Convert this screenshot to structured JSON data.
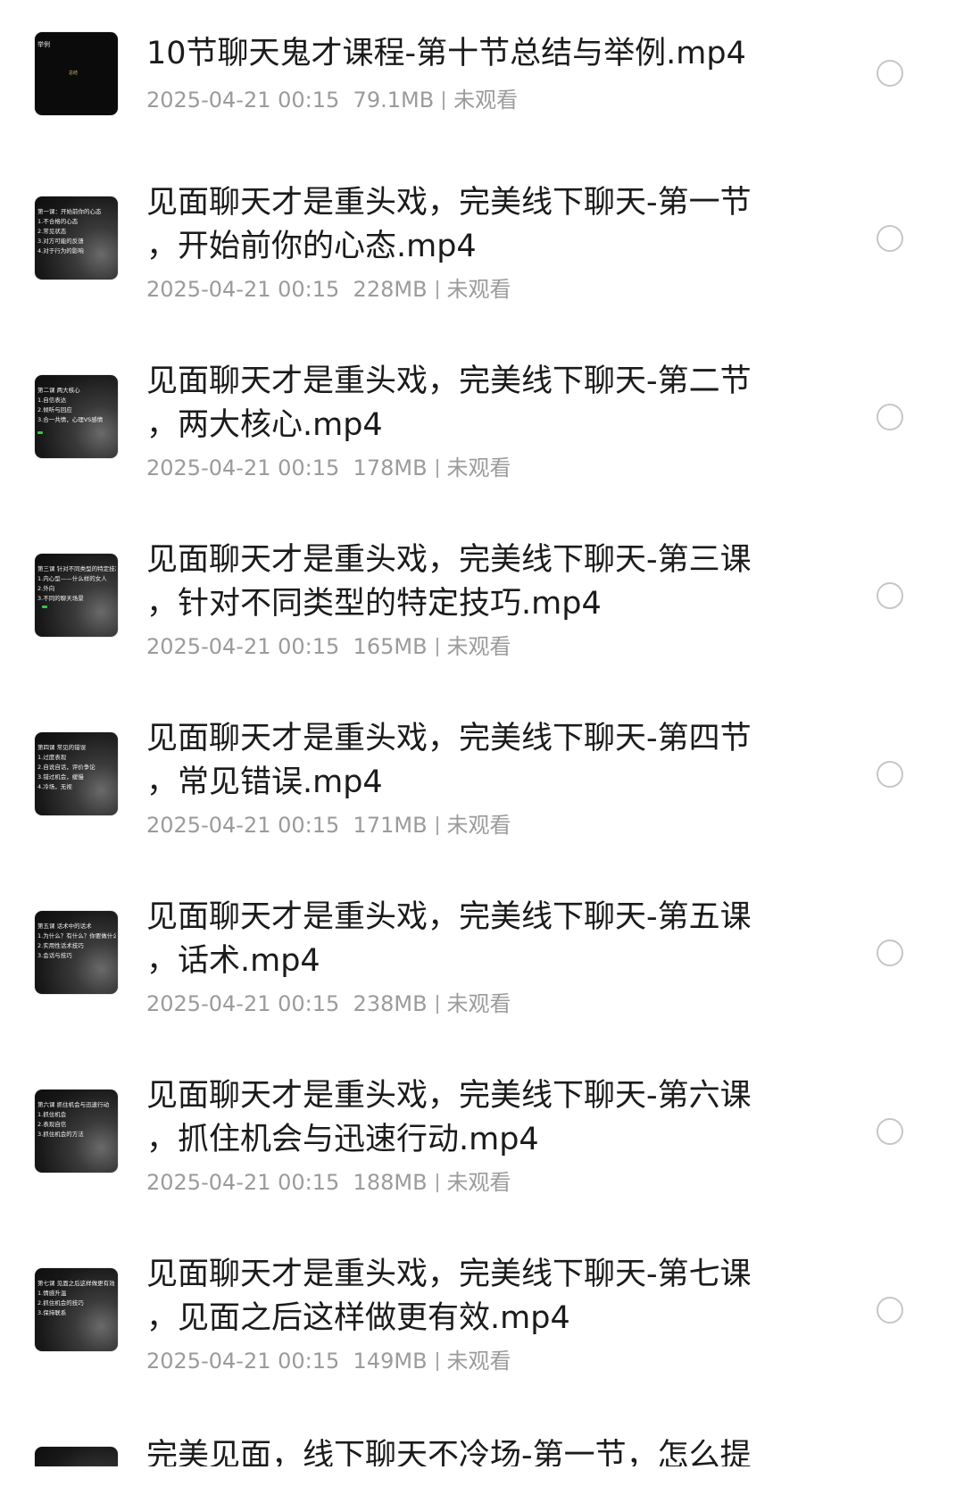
{
  "items": [
    {
      "title_line1": "10节聊天鬼才课程-第十节总结与举例.mp4",
      "title_line2": "",
      "date": "2025-04-21 00:15",
      "size": "79.1MB",
      "status": "未观看"
    },
    {
      "title_line1": "见面聊天才是重头戏，完美线下聊天-第一节",
      "title_line2": "，开始前你的心态.mp4",
      "date": "2025-04-21 00:15",
      "size": "228MB",
      "status": "未观看"
    },
    {
      "title_line1": "见面聊天才是重头戏，完美线下聊天-第二节",
      "title_line2": "，两大核心.mp4",
      "date": "2025-04-21 00:15",
      "size": "178MB",
      "status": "未观看"
    },
    {
      "title_line1": "见面聊天才是重头戏，完美线下聊天-第三课",
      "title_line2": "，针对不同类型的特定技巧.mp4",
      "date": "2025-04-21 00:15",
      "size": "165MB",
      "status": "未观看"
    },
    {
      "title_line1": "见面聊天才是重头戏，完美线下聊天-第四节",
      "title_line2": "，常见错误.mp4",
      "date": "2025-04-21 00:15",
      "size": "171MB",
      "status": "未观看"
    },
    {
      "title_line1": "见面聊天才是重头戏，完美线下聊天-第五课",
      "title_line2": "，话术.mp4",
      "date": "2025-04-21 00:15",
      "size": "238MB",
      "status": "未观看"
    },
    {
      "title_line1": "见面聊天才是重头戏，完美线下聊天-第六课",
      "title_line2": "，抓住机会与迅速行动.mp4",
      "date": "2025-04-21 00:15",
      "size": "188MB",
      "status": "未观看"
    },
    {
      "title_line1": "见面聊天才是重头戏，完美线下聊天-第七课",
      "title_line2": "，见面之后这样做更有效.mp4",
      "date": "2025-04-21 00:15",
      "size": "149MB",
      "status": "未观看"
    },
    {
      "title_line1": "完美见面，线下聊天不冷场-第一节，怎么提",
      "title_line2": "",
      "date": "",
      "size": "",
      "status": ""
    }
  ],
  "thumbs": [
    {
      "text": "举例",
      "center": "总结"
    },
    {
      "text": "第一课：开始前你的心态\n1.不合格的心态\n2.常见状态\n3.对方可能的反馈\n4.对于行为的影响"
    },
    {
      "text": "第二课 两大核心\n1.自信表达\n2.倾听与回应\n3.合一共情，心理VS感情"
    },
    {
      "text": "第三课 针对不同类型的特定技巧\n1.内心型——什么样的女人\n2.外向\n3.不同的聊天场景"
    },
    {
      "text": "第四课 常见的错误\n1.过度表现\n2.自说自话，评价争论\n3.错过机会，缓慢\n4.冷场，无视"
    },
    {
      "text": "第五课 话术中的话术\n1.为什么？有什么？你要做什么\n2.实用性话术技巧\n3.会话与技巧"
    },
    {
      "text": "第六课 抓住机会与迅速行动\n1.抓住机会\n2.表现自信\n3.抓住机会的方法"
    },
    {
      "text": "第七课 见面之后这样做更有效\n1.情感升温\n2.抓住机会的技巧\n3.保持联系"
    }
  ]
}
